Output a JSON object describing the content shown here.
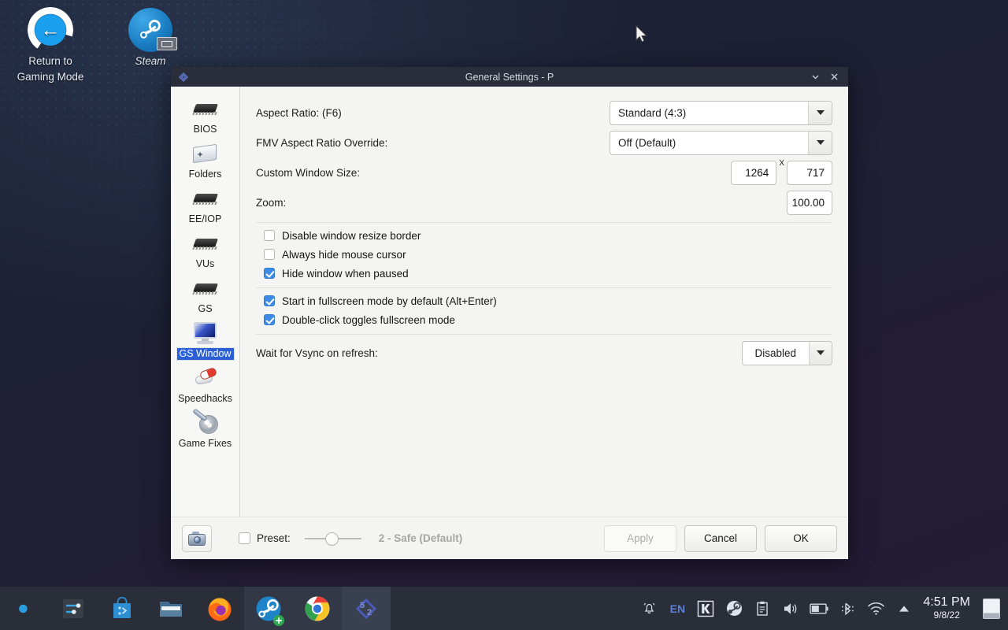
{
  "desktop": {
    "icons": [
      {
        "name": "return-to-gaming-mode",
        "label_line1": "Return to",
        "label_line2": "Gaming Mode"
      },
      {
        "name": "steam",
        "label_line1": "Steam",
        "label_line2": ""
      }
    ]
  },
  "window": {
    "title": "General Settings - P",
    "minimize_icon": "chevron-down-icon",
    "close_icon": "close-icon",
    "app_icon": "pcsx2-icon"
  },
  "sidebar": {
    "items": [
      {
        "label": "BIOS",
        "icon": "chip-icon",
        "selected": false
      },
      {
        "label": "Folders",
        "icon": "folder-icon",
        "selected": false
      },
      {
        "label": "EE/IOP",
        "icon": "chip-icon",
        "selected": false
      },
      {
        "label": "VUs",
        "icon": "chip-icon",
        "selected": false
      },
      {
        "label": "GS",
        "icon": "chip-icon",
        "selected": false
      },
      {
        "label": "GS Window",
        "icon": "monitor-icon",
        "selected": true
      },
      {
        "label": "Speedhacks",
        "icon": "pills-icon",
        "selected": false
      },
      {
        "label": "Game Fixes",
        "icon": "disc-wrench-icon",
        "selected": false
      }
    ]
  },
  "settings": {
    "aspect_ratio": {
      "label": "Aspect Ratio: (F6)",
      "value": "Standard (4:3)"
    },
    "fmv_override": {
      "label": "FMV Aspect Ratio Override:",
      "value": "Off (Default)"
    },
    "custom_window_size": {
      "label": "Custom Window Size:",
      "width": "1264",
      "separator": "X",
      "height": "717"
    },
    "zoom": {
      "label": "Zoom:",
      "value": "100.00"
    },
    "checkboxes": [
      {
        "label": "Disable window resize border",
        "checked": false
      },
      {
        "label": "Always hide mouse cursor",
        "checked": false
      },
      {
        "label": "Hide window when paused",
        "checked": true
      },
      {
        "label": "Start in fullscreen mode by default (Alt+Enter)",
        "checked": true
      },
      {
        "label": "Double-click toggles fullscreen mode",
        "checked": true
      }
    ],
    "vsync": {
      "label": "Wait for Vsync on refresh:",
      "value": "Disabled"
    }
  },
  "footer": {
    "screenshot_icon": "camera-icon",
    "preset_label": "Preset:",
    "preset_checked": false,
    "preset_value": "2 - Safe (Default)",
    "buttons": [
      {
        "label": "Apply",
        "disabled": true
      },
      {
        "label": "Cancel",
        "disabled": false
      },
      {
        "label": "OK",
        "disabled": false
      }
    ]
  },
  "taskbar": {
    "launchers": [
      {
        "name": "app-launcher-icon",
        "state": "idle"
      },
      {
        "name": "settings-sliders-icon",
        "state": "idle"
      },
      {
        "name": "discover-store-icon",
        "state": "idle"
      },
      {
        "name": "file-manager-icon",
        "state": "idle"
      },
      {
        "name": "firefox-icon",
        "state": "idle"
      },
      {
        "name": "steam-icon",
        "state": "running"
      },
      {
        "name": "chrome-icon",
        "state": "running"
      },
      {
        "name": "pcsx2-icon",
        "state": "active"
      }
    ],
    "tray": [
      {
        "name": "notifications-bell-icon"
      },
      {
        "name": "keyboard-layout-indicator",
        "label": "EN"
      },
      {
        "name": "kde-connect-icon"
      },
      {
        "name": "steam-tray-icon"
      },
      {
        "name": "clipboard-icon"
      },
      {
        "name": "volume-icon"
      },
      {
        "name": "battery-icon"
      },
      {
        "name": "bluetooth-icon"
      },
      {
        "name": "wifi-icon"
      },
      {
        "name": "show-hidden-tray-icon"
      }
    ],
    "clock": {
      "time": "4:51 PM",
      "date": "9/8/22"
    },
    "show_desktop_icon": "show-desktop-icon"
  },
  "colors": {
    "accent_blue": "#3c8ce7",
    "selection_blue": "#2a5fd8",
    "titlebar": "#2a2e3b",
    "window_bg": "#f4f4f2",
    "taskbar": "#2a2e39"
  }
}
